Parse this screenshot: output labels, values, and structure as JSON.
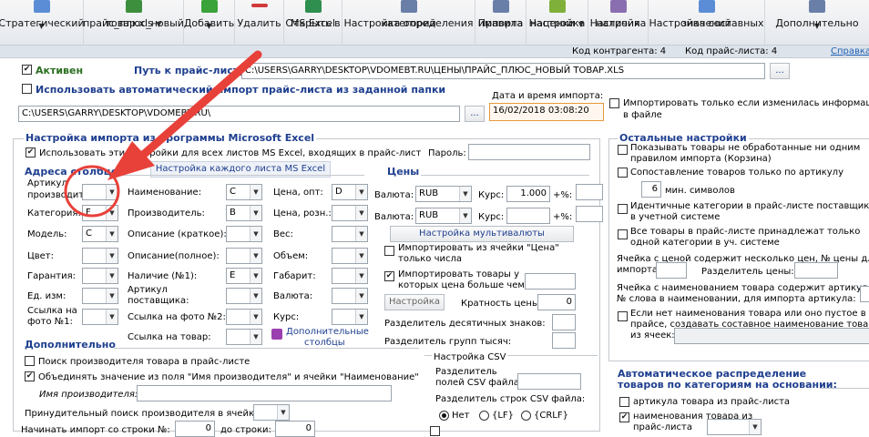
{
  "toolbar": {
    "items": [
      {
        "label1": "Стратегический",
        "label2": "",
        "icon": "strategy-icon",
        "caret": true,
        "color": "#5b8dd6"
      },
      {
        "label1": "прайс_плюс_новый",
        "label2": "товар.xls",
        "icon": "xls-file-icon",
        "caret": true,
        "color": "#3d8f3d"
      },
      {
        "label1": "Добавить",
        "label2": "",
        "icon": "add-icon",
        "caret": true,
        "color": "#3aa33a"
      },
      {
        "label1": "Удалить",
        "label2": "",
        "icon": "delete-icon",
        "caret": false,
        "color": "#d23a3a"
      },
      {
        "label1": "Открыть в",
        "label2": "MS Excel",
        "icon": "excel-icon",
        "caret": false,
        "color": "#2f8f4f"
      },
      {
        "label1": "Настройка определения",
        "label2": "категорий",
        "icon": "category-icon",
        "caret": false,
        "color": "#6a7fa8"
      },
      {
        "label1": "Правила",
        "label2": "импорта",
        "icon": "rules-icon",
        "caret": false,
        "color": "#6a7fa8"
      },
      {
        "label1": "Настройка",
        "label2": "наценки",
        "icon": "markup-icon",
        "caret": true,
        "color": "#7fb03a"
      },
      {
        "label1": "Настройка",
        "label2": "наличия",
        "icon": "stock-icon",
        "caret": false,
        "color": "#8a6fb0"
      },
      {
        "label1": "Настройка составных",
        "label2": "значений",
        "icon": "compound-icon",
        "caret": false,
        "color": "#5b8dd6"
      },
      {
        "label1": "Дополнительно",
        "label2": "",
        "icon": "more-icon",
        "caret": true,
        "color": "#6a7fa8"
      }
    ]
  },
  "infobar": {
    "contractor_code": "Код контрагента: 4",
    "pricelist_code": "Код прайс-листа: 4",
    "help_link": "Справка"
  },
  "top": {
    "active_label": "Активен",
    "path_label": "Путь к прайс-листу:",
    "path_value": "C:\\USERS\\GARRY\\DESKTOP\\VDOMEBT.RU\\ЦЕНЫ\\ПРАЙС_ПЛЮС_НОВЫЙ ТОВАР.XLS",
    "browse": "...",
    "auto_import_label": "Использовать автоматический импорт прайс-листа из заданной папки",
    "folder_value": "C:\\USERS\\GARRY\\DESKTOP\\VDOMEBT.RU\\",
    "import_datetime_label": "Дата и время импорта:",
    "import_datetime_value": "16/02/2018 03:08:20",
    "only_changed_label1": "Импортировать только если изменилась информация",
    "only_changed_label2": "в файле"
  },
  "excel": {
    "title": "Настройка импорта из программы Microsoft Excel",
    "use_settings_label": "Использовать эти настройки для всех листов MS Excel, входящих в прайс-лист",
    "password_label": "Пароль:",
    "each_sheet_button": "Настройка каждого листа MS Excel",
    "columns_title": "Адреса столбцов",
    "prices_title": "Цены",
    "col1": [
      {
        "label": "Артикул",
        "label2": "производителя:",
        "value": ""
      },
      {
        "label": "Категория:",
        "value": "F"
      },
      {
        "label": "Модель:",
        "value": "C"
      },
      {
        "label": "Цвет:",
        "value": ""
      },
      {
        "label": "Гарантия:",
        "value": ""
      },
      {
        "label": "Ед. изм:",
        "value": ""
      },
      {
        "label": "Ссылка на",
        "label2": "фото №1:",
        "value": ""
      }
    ],
    "col2": [
      {
        "label": "Наименование:",
        "value": "C"
      },
      {
        "label": "Производитель:",
        "value": "B"
      },
      {
        "label": "Описание (краткое):",
        "value": ""
      },
      {
        "label": "Описание(полное):",
        "value": ""
      },
      {
        "label": "Наличие (№1):",
        "value": "E"
      },
      {
        "label": "Артикул",
        "label2": "поставщика:",
        "value": ""
      },
      {
        "label": "Ссылка на фото №2:",
        "value": ""
      },
      {
        "label": "Ссылка на товар:",
        "value": ""
      }
    ],
    "col3": [
      {
        "label": "Цена, опт:",
        "value": "D"
      },
      {
        "label": "Цена, розн.:",
        "value": ""
      },
      {
        "label": "Вес:",
        "value": ""
      },
      {
        "label": "Объем:",
        "value": ""
      },
      {
        "label": "Габарит:",
        "value": ""
      },
      {
        "label": "Валюта:",
        "value": ""
      },
      {
        "label": "Курс:",
        "value": ""
      }
    ],
    "extra_columns_label1": "Дополнительные",
    "extra_columns_label2": "столбцы",
    "currency_rows": [
      {
        "label": "Валюта:",
        "value": "RUB",
        "rate_label": "Курс:",
        "rate_value": "1.000",
        "pct_label": "+%:"
      },
      {
        "label": "Валюта:",
        "value": "RUB",
        "rate_label": "Курс:",
        "rate_value": "",
        "pct_label": "+%:"
      }
    ],
    "multicurrency_button": "Настройка мультивалюты",
    "import_price_only_numbers1": "Импортировать из ячейки \"Цена\"",
    "import_price_only_numbers2": "только числа",
    "import_price_more1": "Импортировать товары у",
    "import_price_more2": "которых цена больше чем:",
    "settings_button": "Настройка",
    "multiplicity_label": "Кратность цены:",
    "multiplicity_value": "0",
    "decimal_sep_label": "Разделитель десятичных знаков:",
    "group_sep_label": "Разделитель групп тысяч:"
  },
  "additional": {
    "title": "Дополнительно",
    "search_manufacturer": "Поиск производителя товара в прайс-листе",
    "merge_names": "Объединять значение из поля \"Имя производителя\" и ячейки \"Наименование\"",
    "manufacturer_name_label": "Имя производителя:",
    "force_search_label": "Принудительный поиск производителя в ячейке:",
    "start_row_label": "Начинать импорт со строки №:",
    "start_row_value": "0",
    "to_row_label": "до строки:",
    "to_row_value": "0"
  },
  "csv": {
    "title": "Настройка CSV",
    "field_sep_label1": "Разделитель",
    "field_sep_label2": "полей CSV файла:",
    "row_sep_label": "Разделитель строк CSV файла:",
    "options": [
      "Нет",
      "{LF}",
      "{CRLF}"
    ]
  },
  "other": {
    "title": "Остальные настройки",
    "items": [
      {
        "text1": "Показывать товары не обработанные ни одним",
        "text2": "правилом импорта (Корзина)"
      },
      {
        "text1": "Сопоставление товаров только по артикулу",
        "text2": ""
      }
    ],
    "min_chars_value": "6",
    "min_chars_label": "мин. символов",
    "items2": [
      {
        "text1": "Идентичные категории в прайс-листе поставщика",
        "text2": "в учетной системе"
      },
      {
        "text1": "Все товары в прайс-листе принадлежат только",
        "text2": "одной категории в уч. системе"
      }
    ],
    "cell_prices_text1": "Ячейка с ценой содержит несколько цен, № цены для",
    "cell_prices_text2": "импорта:",
    "price_sep_label": "Разделитель цены:",
    "cell_name_text1": "Ячейка с наименованием товара содержит артикул,",
    "cell_name_text2": "№ слова в наименовании, для импорта артикула:",
    "no_name_text1": "Если нет наименования товара или оно пустое в",
    "no_name_text2": "прайсе, создавать составное наименование товара",
    "no_name_text3": "из ячеек:"
  },
  "auto_category": {
    "title1": "Автоматическое распределение",
    "title2": "товаров по категориям на основании:",
    "item1": "артикула товара из прайс-листа",
    "item2a": "наименования товара из",
    "item2b": "прайс-листа"
  },
  "annotation": {
    "color": "#e8413a"
  }
}
